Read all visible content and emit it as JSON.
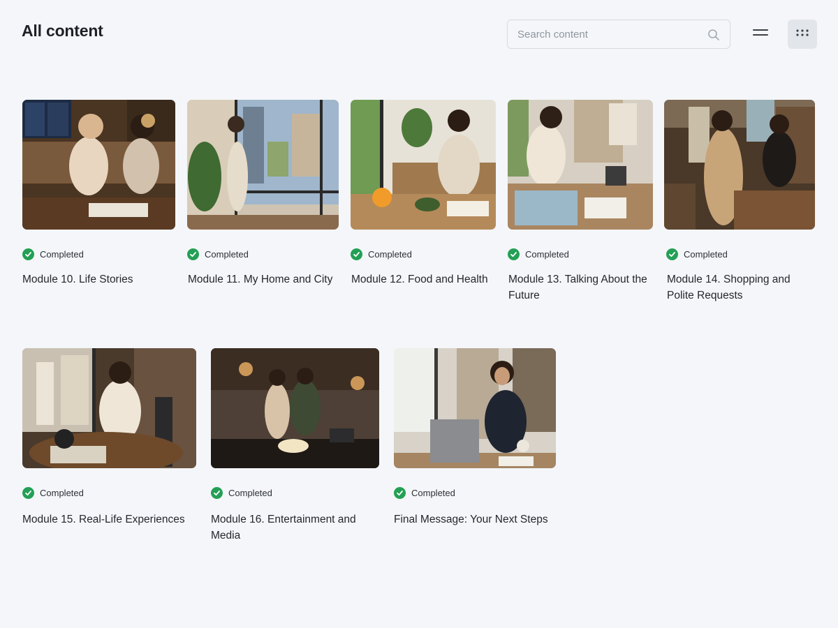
{
  "header": {
    "title": "All content",
    "search_placeholder": "Search content"
  },
  "icons": {
    "search": "search-icon",
    "list_view": "list-view-icon",
    "grid_view": "grid-view-icon",
    "status": "check-circle-icon"
  },
  "colors": {
    "completed": "#23a055",
    "active_view_bg": "#e2e5ea"
  },
  "modules": [
    {
      "status": "Completed",
      "title": "Module 10. Life Stories"
    },
    {
      "status": "Completed",
      "title": "Module 11. My Home and City"
    },
    {
      "status": "Completed",
      "title": "Module 12. Food and Health"
    },
    {
      "status": "Completed",
      "title": "Module 13. Talking About the Future"
    },
    {
      "status": "Completed",
      "title": "Module 14. Shopping and Polite Requests"
    },
    {
      "status": "Completed",
      "title": "Module 15. Real-Life Experiences"
    },
    {
      "status": "Completed",
      "title": "Module 16. Entertainment and Media"
    },
    {
      "status": "Completed",
      "title": "Final Message: Your Next Steps"
    }
  ]
}
